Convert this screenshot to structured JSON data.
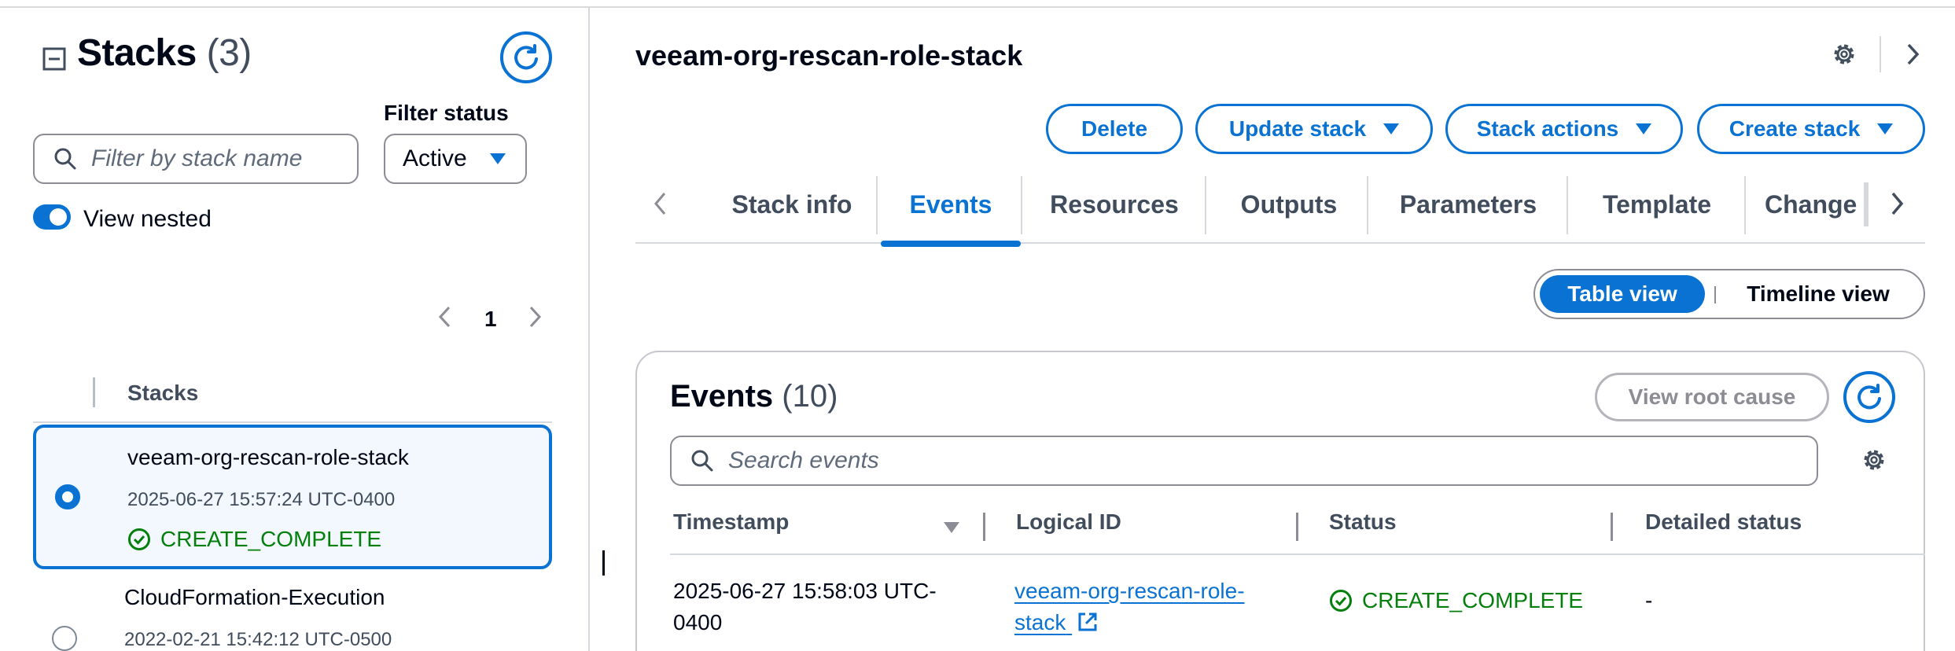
{
  "sidebar": {
    "title": "Stacks",
    "count": "(3)",
    "filter_label": "Filter status",
    "search_placeholder": "Filter by stack name",
    "filter_value": "Active",
    "view_nested_label": "View nested",
    "page_number": "1",
    "column_header": "Stacks",
    "stacks": [
      {
        "name": "veeam-org-rescan-role-stack",
        "date": "2025-06-27 15:57:24 UTC-0400",
        "status": "CREATE_COMPLETE"
      },
      {
        "name": "CloudFormation-Execution",
        "date": "2022-02-21 15:42:12 UTC-0500"
      }
    ]
  },
  "detail": {
    "title": "veeam-org-rescan-role-stack",
    "buttons": {
      "delete": "Delete",
      "update": "Update stack",
      "actions": "Stack actions",
      "create": "Create stack"
    },
    "tabs": [
      "Stack info",
      "Events",
      "Resources",
      "Outputs",
      "Parameters",
      "Template",
      "Change"
    ],
    "view_toggle": {
      "table": "Table view",
      "timeline": "Timeline view"
    }
  },
  "events": {
    "title": "Events",
    "count": "(10)",
    "root_cause_label": "View root cause",
    "search_placeholder": "Search events",
    "columns": [
      "Timestamp",
      "Logical ID",
      "Status",
      "Detailed status"
    ],
    "rows": [
      {
        "timestamp": "2025-06-27 15:58:03 UTC-0400",
        "logical_id": "veeam-org-rescan-role-stack",
        "status": "CREATE_COMPLETE",
        "detailed": "-"
      }
    ]
  },
  "colors": {
    "accent": "#0972d3",
    "success": "#037f0c",
    "text": "#000716"
  }
}
